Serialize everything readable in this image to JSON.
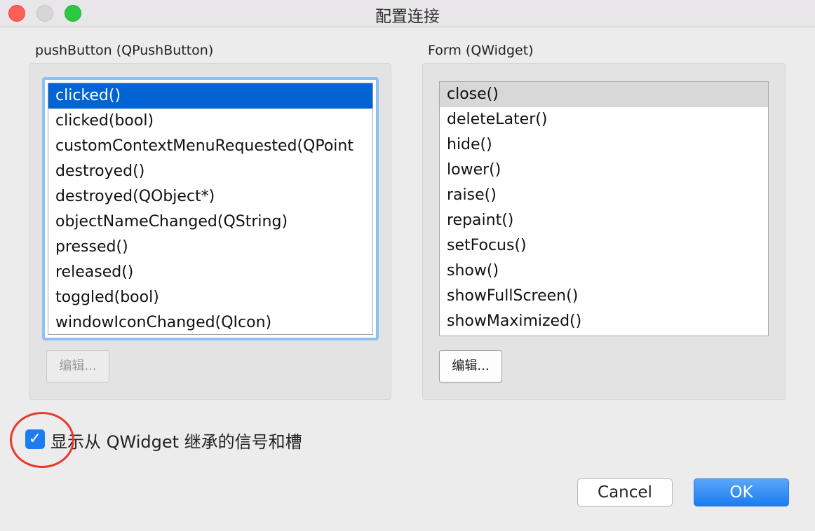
{
  "window": {
    "title": "配置连接"
  },
  "sender": {
    "label": "pushButton (QPushButton)",
    "items": [
      "clicked()",
      "clicked(bool)",
      "customContextMenuRequested(QPoint",
      "destroyed()",
      "destroyed(QObject*)",
      "objectNameChanged(QString)",
      "pressed()",
      "released()",
      "toggled(bool)",
      "windowIconChanged(QIcon)"
    ],
    "selected_index": 0,
    "edit_label": "编辑..."
  },
  "receiver": {
    "label": "Form (QWidget)",
    "items": [
      "close()",
      "deleteLater()",
      "hide()",
      "lower()",
      "raise()",
      "repaint()",
      "setFocus()",
      "show()",
      "showFullScreen()",
      "showMaximized()"
    ],
    "selected_index": 0,
    "edit_label": "编辑..."
  },
  "options": {
    "show_inherited_label": "显示从 QWidget 继承的信号和槽",
    "show_inherited_checked": true
  },
  "buttons": {
    "cancel": "Cancel",
    "ok": "OK"
  },
  "colors": {
    "selection_active": "#0064d2",
    "selection_inactive": "#d8d8d8",
    "accent": "#1c7cf2",
    "annotation": "#e9392b"
  }
}
